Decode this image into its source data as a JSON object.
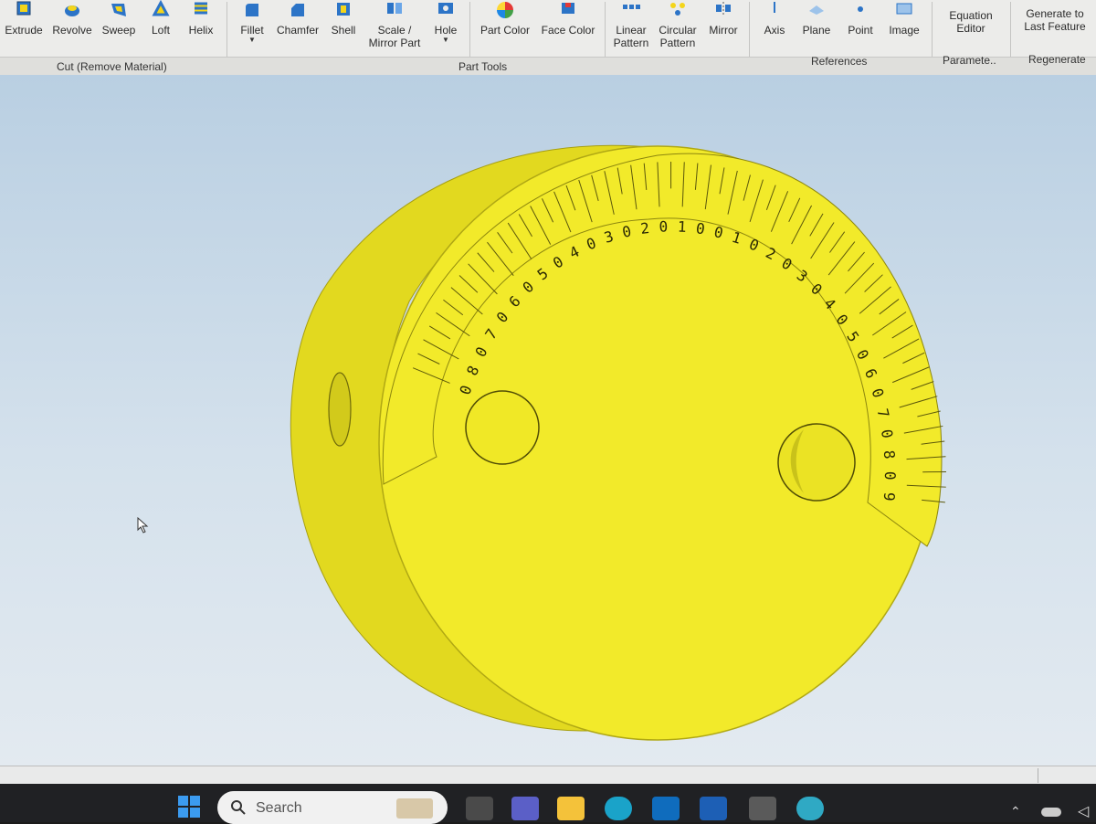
{
  "ribbon": {
    "tools": [
      {
        "label": "Extrude",
        "icon": "extrude-icon"
      },
      {
        "label": "Revolve",
        "icon": "revolve-icon"
      },
      {
        "label": "Sweep",
        "icon": "sweep-icon"
      },
      {
        "label": "Loft",
        "icon": "loft-icon"
      },
      {
        "label": "Helix",
        "icon": "helix-icon"
      },
      {
        "label": "Fillet",
        "icon": "fillet-icon"
      },
      {
        "label": "Chamfer",
        "icon": "chamfer-icon"
      },
      {
        "label": "Shell",
        "icon": "shell-icon"
      },
      {
        "label": "Scale /\nMirror Part",
        "icon": "scale-mirror-icon"
      },
      {
        "label": "Hole",
        "icon": "hole-icon"
      },
      {
        "label": "Part Color",
        "icon": "part-color-icon"
      },
      {
        "label": "Face Color",
        "icon": "face-color-icon"
      },
      {
        "label": "Linear\nPattern",
        "icon": "linear-pattern-icon"
      },
      {
        "label": "Circular\nPattern",
        "icon": "circular-pattern-icon"
      },
      {
        "label": "Mirror",
        "icon": "mirror-icon"
      },
      {
        "label": "Axis",
        "icon": "axis-icon"
      },
      {
        "label": "Plane",
        "icon": "plane-icon"
      },
      {
        "label": "Point",
        "icon": "point-icon"
      },
      {
        "label": "Image",
        "icon": "image-icon"
      },
      {
        "label": "Equation\nEditor",
        "icon": "equation-editor-icon"
      },
      {
        "label": "Generate to\nLast Feature",
        "icon": "generate-icon"
      }
    ],
    "groups": {
      "cut": "Cut (Remove Material)",
      "part_tools": "Part Tools",
      "references": "References",
      "parameters": "Paramete..",
      "regenerate": "Regenerate"
    }
  },
  "dial": {
    "scale_top": [
      "0",
      "8",
      "0",
      "7",
      "0",
      "6",
      "0",
      "5",
      "0",
      "4",
      "0",
      "3",
      "0",
      "2",
      "0",
      "1",
      "0",
      "0",
      "1",
      "0",
      "2",
      "0",
      "3",
      "0",
      "4",
      "0",
      "5",
      "0",
      "6",
      "0",
      "7",
      "0",
      "8",
      "0",
      "9"
    ],
    "color": "#f2ea2a"
  },
  "taskbar": {
    "search_label": "Search",
    "icons": [
      "windows-start-icon",
      "search-icon",
      "task-view-icon",
      "teams-icon",
      "file-explorer-icon",
      "edge-icon",
      "outlook-icon",
      "word-icon",
      "calculator-icon",
      "cortana-icon",
      "tray-chevron-icon",
      "cloud-icon",
      "send-icon"
    ]
  },
  "colors": {
    "accent": "#1e6fd0",
    "part": "#f2ea2a",
    "viewport": "#c9d9e6"
  }
}
